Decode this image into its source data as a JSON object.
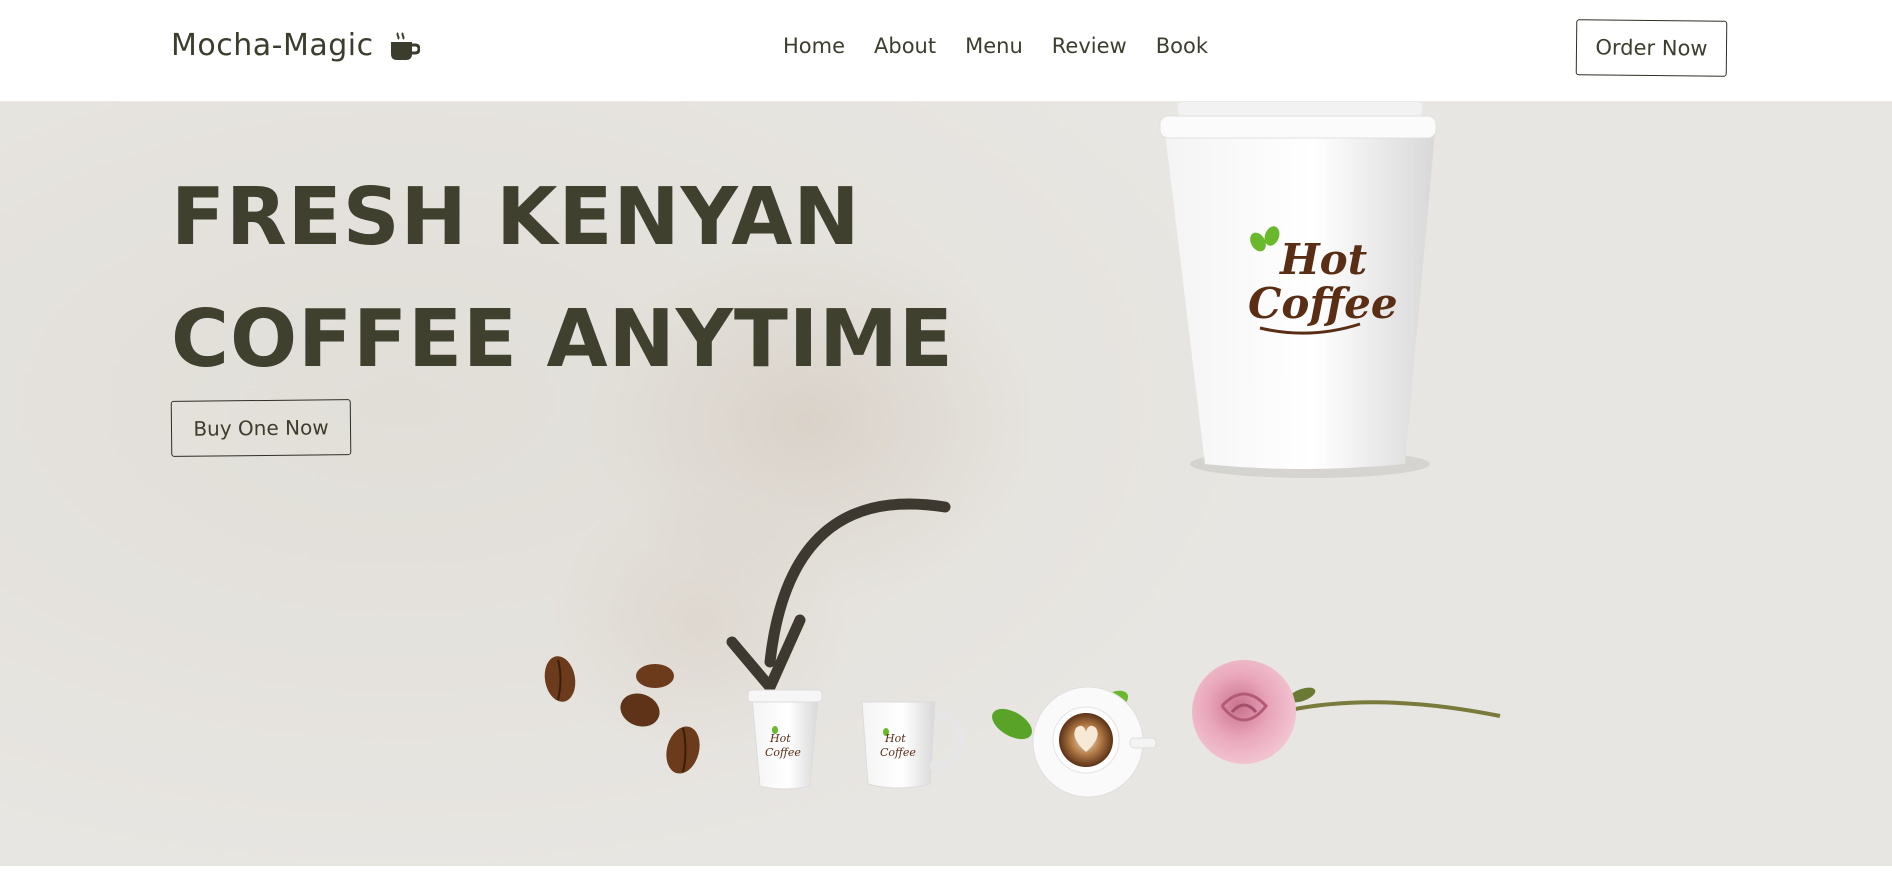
{
  "header": {
    "logo_text": "Mocha-Magic",
    "logo_icon": "coffee-cup-icon",
    "nav": [
      "Home",
      "About",
      "Menu",
      "Review",
      "Book"
    ],
    "order_label": "Order Now"
  },
  "hero": {
    "title_line1": "FRESH KENYAN",
    "title_line2": "COFFEE ANYTIME",
    "cta_label": "Buy One Now",
    "cup_logo_line1": "Hot",
    "cup_logo_line2": "Coffee"
  },
  "colors": {
    "text_dark": "#3d3d2e",
    "header_bg": "#ffffff",
    "hero_bg": "#e6e4df",
    "leaf_green": "#6ab82c",
    "logo_brown": "#5a2e14"
  }
}
